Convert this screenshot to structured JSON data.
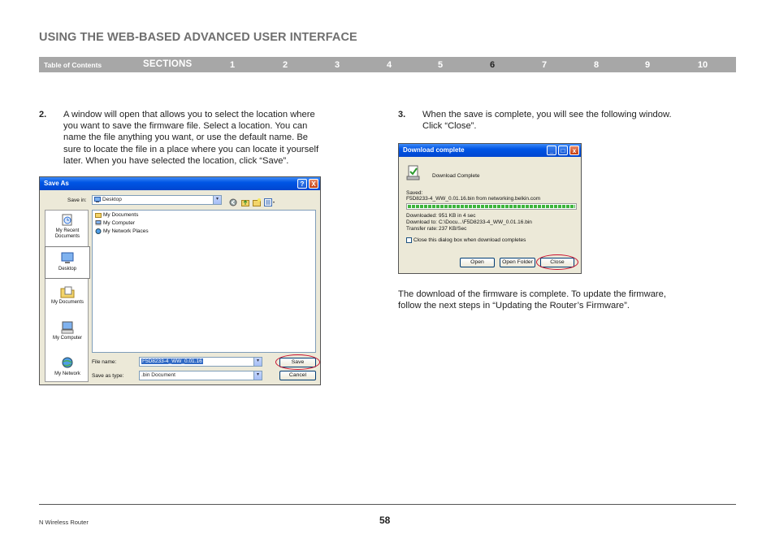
{
  "header": {
    "title": "USING THE WEB-BASED ADVANCED USER INTERFACE"
  },
  "nav": {
    "toc": "Table of Contents",
    "sections": "SECTIONS",
    "numbers": [
      "1",
      "2",
      "3",
      "4",
      "5",
      "6",
      "7",
      "8",
      "9",
      "10"
    ],
    "active": "6"
  },
  "step2": {
    "num": "2.",
    "lines": [
      "A window will open that allows you to select the location where",
      "you want to save the firmware file. Select a location. You can",
      "name the file anything you want, or use the default name. Be",
      "sure to locate the file in a place where you can locate it yourself",
      "later. When you have selected the location, click “Save”."
    ]
  },
  "step3": {
    "num": "3.",
    "lines": [
      "When the save is complete, you will see the following window.",
      "Click “Close”."
    ]
  },
  "closing": {
    "lines": [
      "The download of the firmware is complete. To update the firmware,",
      "follow the next steps in “Updating the Router’s Firmware”."
    ]
  },
  "save_dialog": {
    "title": "Save As",
    "help_btn": "?",
    "close_btn": "X",
    "save_in_label": "Save in:",
    "save_in_value": "Desktop",
    "places": [
      "My Recent Documents",
      "Desktop",
      "My Documents",
      "My Computer",
      "My Network"
    ],
    "files": [
      "My Documents",
      "My Computer",
      "My Network Places"
    ],
    "file_name_label": "File name:",
    "file_name_value": "F5D8233-4_WW_0.01.16",
    "save_type_label": "Save as type:",
    "save_type_value": ".bin Document",
    "save_button": "Save",
    "cancel_button": "Cancel"
  },
  "download_dialog": {
    "title": "Download complete",
    "heading": "Download Complete",
    "saved_label": "Saved:",
    "saved_value": "F5D8233-4_WW_0.01.16.bin from networking.belkin.com",
    "progress": 1.0,
    "downloaded_label": "Downloaded:",
    "downloaded_value": "951 KB in 4 sec",
    "download_to_label": "Download to:",
    "download_to_value": "C:\\Docu...\\F5D8233-4_WW_0.01.16.bin",
    "transfer_rate_label": "Transfer rate:",
    "transfer_rate_value": "237 KB/Sec",
    "checkbox_label": "Close this dialog box when download completes",
    "open_button": "Open",
    "open_folder_button": "Open Folder",
    "close_button": "Close"
  },
  "footer": {
    "product": "N Wireless Router",
    "page": "58"
  },
  "colors": {
    "nav_bar": "#a7a7a7",
    "title_gray": "#6f6f6f",
    "xp_blue": "#0055e5",
    "highlight_red": "#c8102e"
  }
}
